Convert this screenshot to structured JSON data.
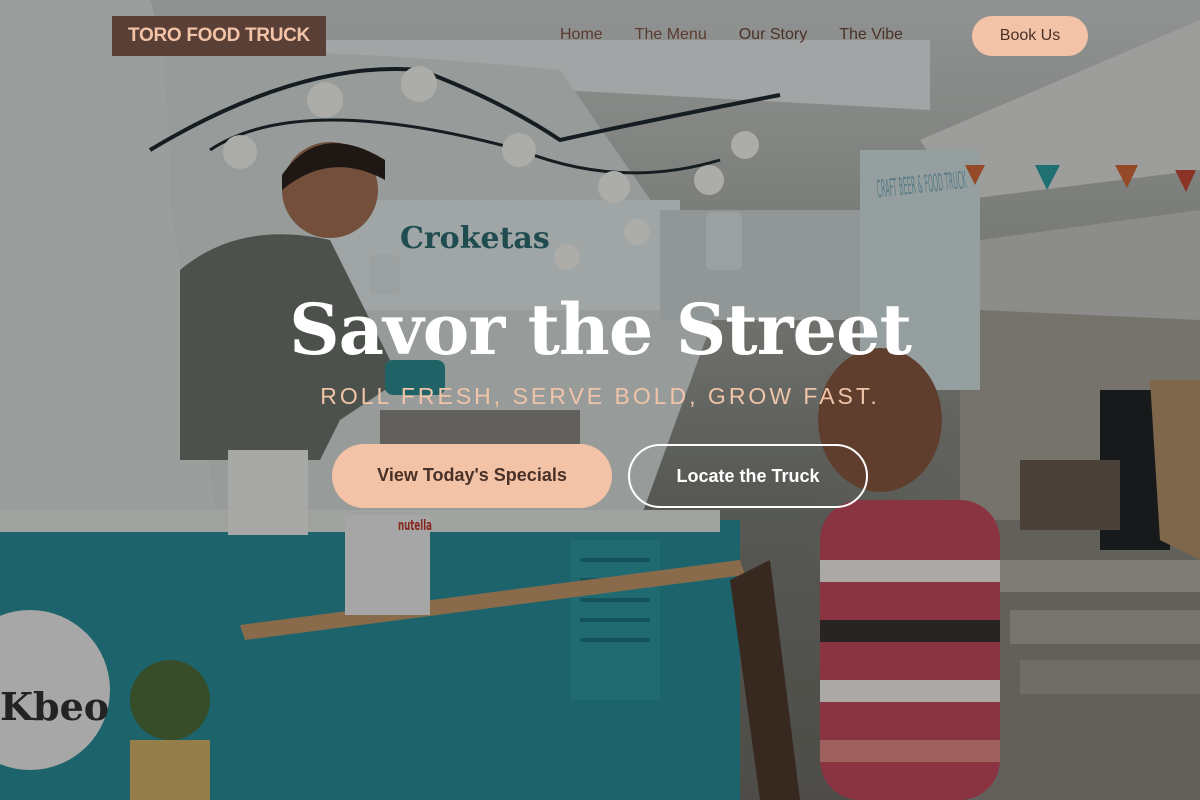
{
  "brand": {
    "name": "TORO FOOD TRUCK",
    "accent_color": "#f2c3a6",
    "logo_bg_color": "#5a3f37",
    "text_dark_color": "#4a3128"
  },
  "nav": {
    "links": [
      {
        "label": "Home"
      },
      {
        "label": "The Menu"
      },
      {
        "label": "Our Story"
      },
      {
        "label": "The Vibe"
      }
    ],
    "cta_label": "Book Us"
  },
  "hero": {
    "title": "Savor the Street",
    "tagline": "ROLL FRESH, SERVE BOLD, GROW FAST.",
    "primary_cta": "View Today's Specials",
    "secondary_cta": "Locate the Truck",
    "background_scene": {
      "truck_sign": "Croketas",
      "banner_text": "CRAFT BEER & FOOD TRUCK",
      "jar_label": "nutella",
      "badge_text": "Kbeo"
    }
  }
}
